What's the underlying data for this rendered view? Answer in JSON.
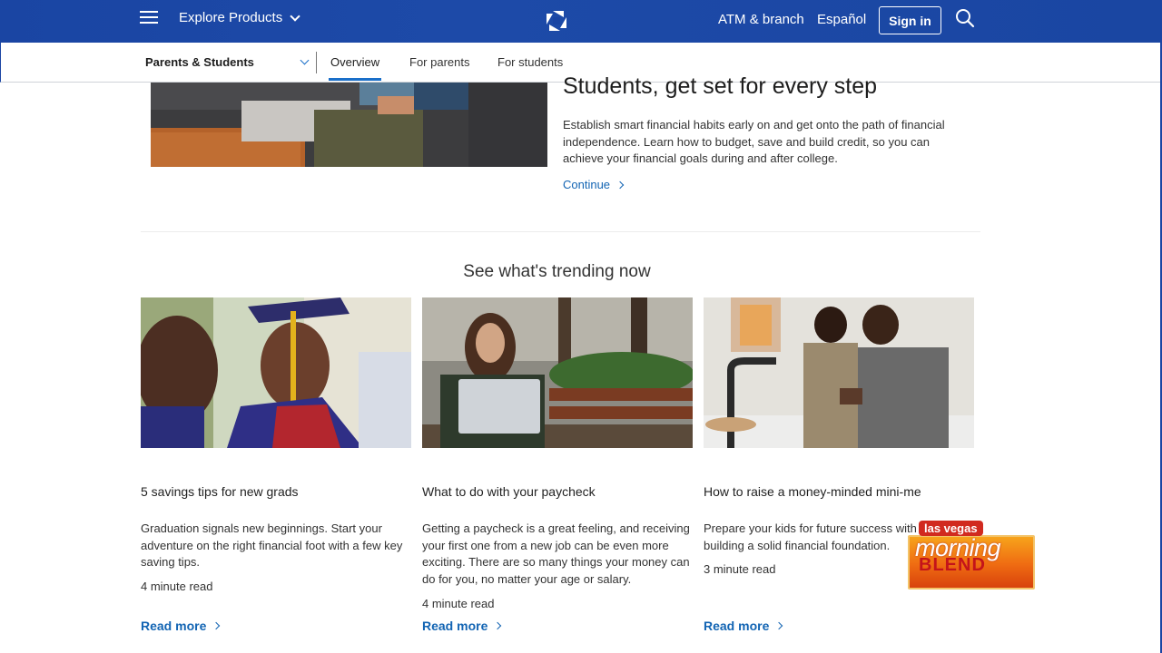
{
  "topbar": {
    "explore_label": "Explore Products",
    "atm_label": "ATM & branch",
    "lang_label": "Español",
    "signin_label": "Sign in"
  },
  "subnav": {
    "section_label": "Parents & Students",
    "tabs": [
      {
        "label": "Overview",
        "active": true
      },
      {
        "label": "For parents",
        "active": false
      },
      {
        "label": "For students",
        "active": false
      }
    ]
  },
  "hero": {
    "title": "Students, get set for every step",
    "text": "Establish smart financial habits early on and get onto the path of financial independence. Learn how to budget, save and build credit, so you can achieve your financial goals during and after college.",
    "link": "Continue"
  },
  "trending": {
    "title": "See what's trending now",
    "cards": [
      {
        "title": "5 savings tips for new grads",
        "desc": "Graduation signals new beginnings. Start your adventure on the right financial foot with a few key saving tips.",
        "read_time": "4 minute read",
        "link": "Read more"
      },
      {
        "title": "What to do with your paycheck",
        "desc": "Getting a paycheck is a great feeling, and receiving your first one from a new job can be even more exciting. There are so many things your money can do for you, no matter your age or salary.",
        "read_time": "4 minute read",
        "link": "Read more"
      },
      {
        "title": "How to raise a money-minded mini-me",
        "desc": "Prepare your kids for future success with on building a solid financial foundation.",
        "read_time": "3 minute read",
        "link": "Read more"
      }
    ]
  },
  "overlay": {
    "top": "las vegas",
    "line1": "morning",
    "line2": "BLEND"
  },
  "colors": {
    "brand_blue": "#1a45a3",
    "link_blue": "#1264b3"
  }
}
